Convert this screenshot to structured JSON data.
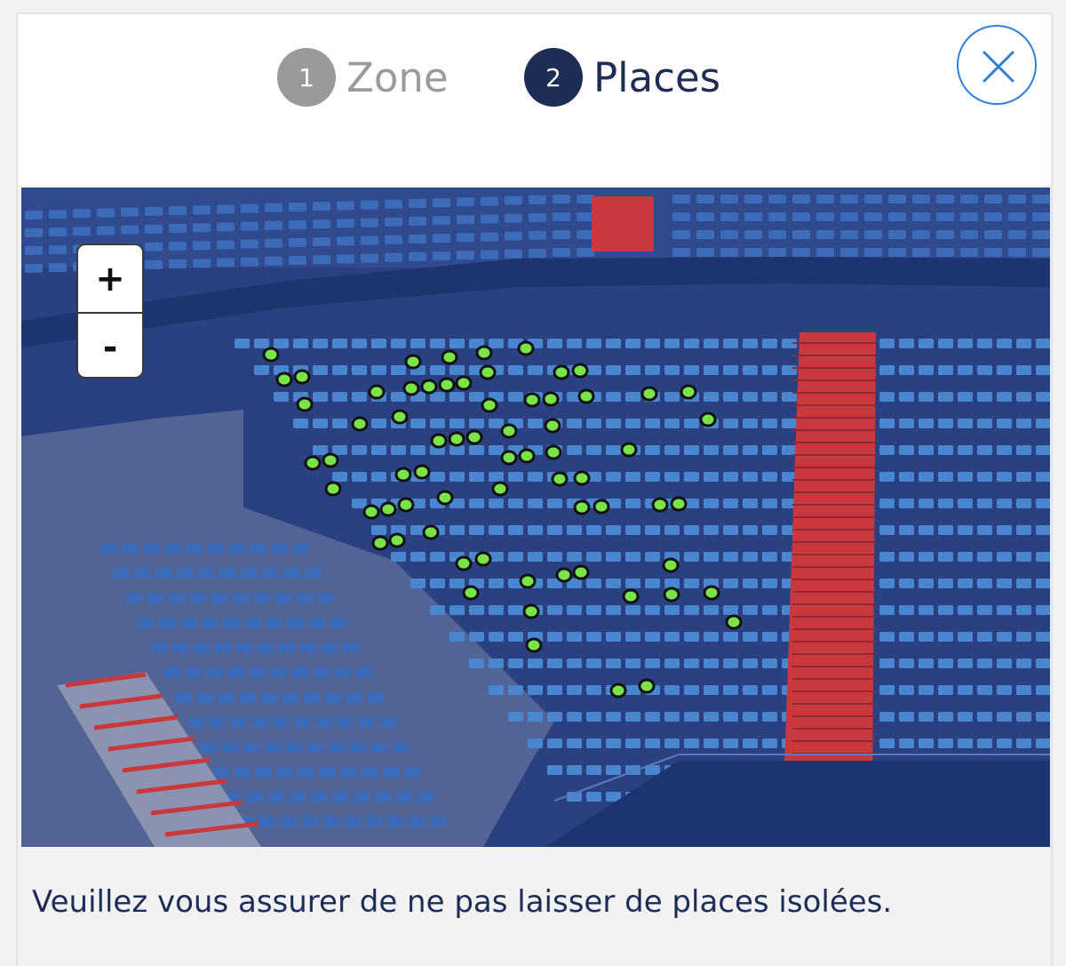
{
  "steps": [
    {
      "number": "1",
      "label": "Zone",
      "state": "inactive"
    },
    {
      "number": "2",
      "label": "Places",
      "state": "active"
    }
  ],
  "close_icon": "close-icon",
  "zoom": {
    "in_label": "+",
    "out_label": "-"
  },
  "seat_map": {
    "available_seat_color": "#7ae34a",
    "seat_color": "#4a86cf",
    "stair_color": "#c8383c",
    "available_seat_count": 72
  },
  "notice": "Veuillez vous assurer de ne pas laisser de places isolées.",
  "colors": {
    "primary": "#1d2d55",
    "inactive": "#9a9a9a",
    "close_border": "#2f7fd6"
  }
}
